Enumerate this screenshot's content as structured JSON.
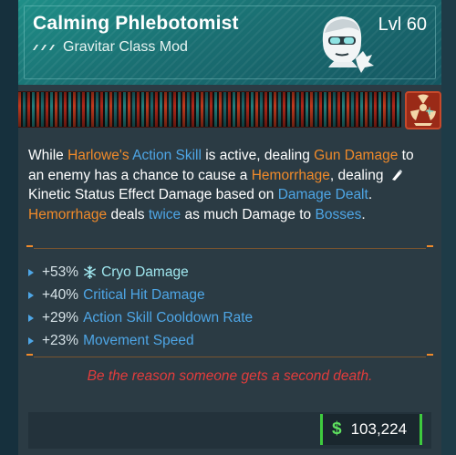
{
  "item": {
    "name": "Calming Phlebotomist",
    "type": "Gravitar Class Mod",
    "level": "Lvl 60",
    "portrait_icon": "character-portrait-icon",
    "element_icon": "radiation-element-icon"
  },
  "description": {
    "p1": "While ",
    "p2": "Harlowe's",
    "p3": " ",
    "p4": "Action Skill",
    "p5": " is active, dealing ",
    "p6": "Gun Damage",
    "p7": " to an enemy has a chance to cause a ",
    "p8": "Hemorrhage",
    "p9": ", dealing ",
    "p10": "Kinetic Status Effect Damage",
    "p11": " based on ",
    "p12": "Damage Dealt",
    "p13": ". ",
    "p14": "Hemorrhage",
    "p15": " deals ",
    "p16": "twice",
    "p17": " as much Damage to ",
    "p18": "Bosses",
    "p19": "."
  },
  "stats": [
    {
      "value": "+53%",
      "label": "Cryo Damage",
      "icon": "cryo-snowflake-icon"
    },
    {
      "value": "+40%",
      "label": "Critical Hit Damage"
    },
    {
      "value": "+29%",
      "label": "Action Skill Cooldown Rate"
    },
    {
      "value": "+23%",
      "label": "Movement Speed"
    }
  ],
  "flavor_text": "Be the reason someone gets a second death.",
  "price": {
    "symbol": "$",
    "amount": "103,224"
  },
  "colors": {
    "header": "#1a6f72",
    "highlight_orange": "#f08a2a",
    "highlight_blue": "#4ea6e6",
    "flavor_red": "#e23c3c",
    "price_green": "#3ecb3e"
  }
}
